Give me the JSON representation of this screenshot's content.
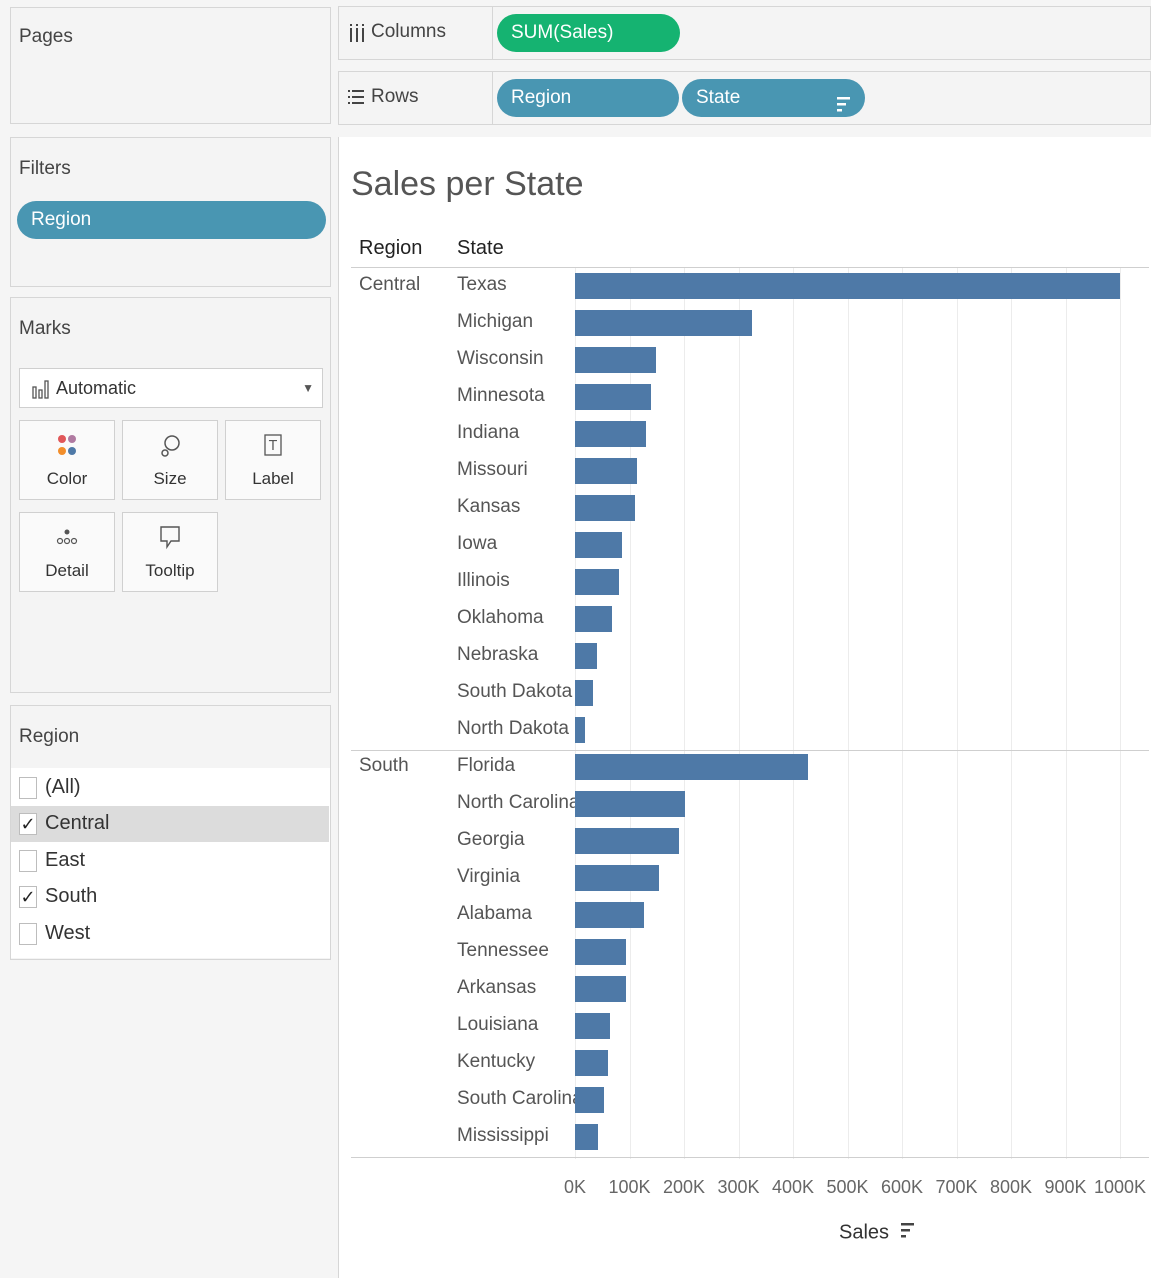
{
  "pages_panel": {
    "title": "Pages"
  },
  "filters_panel": {
    "title": "Filters",
    "pill": "Region"
  },
  "marks_panel": {
    "title": "Marks",
    "mark_type": "Automatic",
    "buttons": [
      {
        "label": "Color",
        "icon": "color-icon"
      },
      {
        "label": "Size",
        "icon": "size-icon"
      },
      {
        "label": "Label",
        "icon": "label-icon"
      },
      {
        "label": "Detail",
        "icon": "detail-icon"
      },
      {
        "label": "Tooltip",
        "icon": "tooltip-icon"
      }
    ]
  },
  "region_filter": {
    "title": "Region",
    "items": [
      {
        "label": "(All)",
        "checked": false
      },
      {
        "label": "Central",
        "checked": true
      },
      {
        "label": "East",
        "checked": false
      },
      {
        "label": "South",
        "checked": true
      },
      {
        "label": "West",
        "checked": false
      }
    ]
  },
  "shelves": {
    "columns": {
      "label": "Columns",
      "pills": [
        "SUM(Sales)"
      ]
    },
    "rows": {
      "label": "Rows",
      "pills": [
        "Region",
        "State"
      ]
    }
  },
  "colors": {
    "bar": "#4e79a7",
    "pill_blue": "#4996b2",
    "pill_green": "#15b371"
  },
  "chart_data": {
    "type": "bar",
    "title": "Sales per State",
    "row_headers": [
      "Region",
      "State"
    ],
    "xlabel": "Sales",
    "xlim": [
      0,
      1000000
    ],
    "x_ticks": [
      "0K",
      "100K",
      "200K",
      "300K",
      "400K",
      "500K",
      "600K",
      "700K",
      "800K",
      "900K",
      "1000K"
    ],
    "groups": [
      {
        "region": "Central",
        "states": [
          "Texas",
          "Michigan",
          "Wisconsin",
          "Minnesota",
          "Indiana",
          "Missouri",
          "Kansas",
          "Iowa",
          "Illinois",
          "Oklahoma",
          "Nebraska",
          "South Dakota",
          "North Dakota"
        ],
        "values": [
          1000000,
          325000,
          148000,
          140000,
          131000,
          113000,
          110000,
          87000,
          81000,
          68000,
          41000,
          33000,
          18000
        ]
      },
      {
        "region": "South",
        "states": [
          "Florida",
          "North Carolina",
          "Georgia",
          "Virginia",
          "Alabama",
          "Tennessee",
          "Arkansas",
          "Louisiana",
          "Kentucky",
          "South Carolina",
          "Mississippi"
        ],
        "values": [
          427000,
          201000,
          190000,
          155000,
          126000,
          94000,
          94000,
          65000,
          60000,
          54000,
          43000
        ]
      }
    ]
  }
}
